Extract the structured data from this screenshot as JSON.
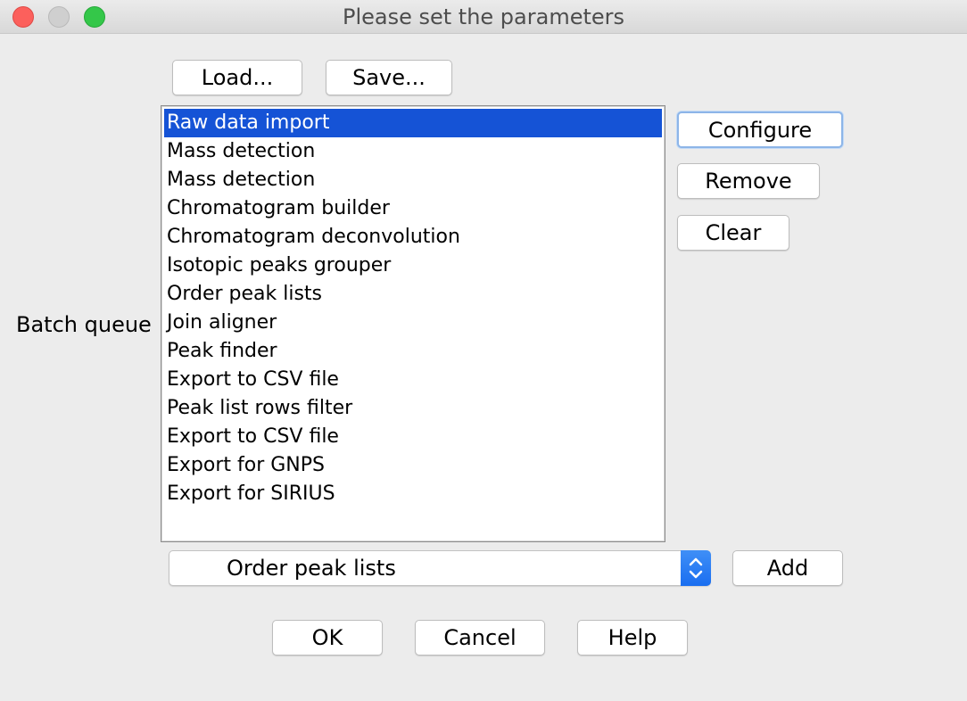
{
  "window": {
    "title": "Please set the parameters"
  },
  "toolbar": {
    "load_label": "Load...",
    "save_label": "Save..."
  },
  "batch_queue": {
    "label": "Batch queue",
    "selected_index": 0,
    "items": [
      "Raw data import",
      "Mass detection",
      "Mass detection",
      "Chromatogram builder",
      "Chromatogram deconvolution",
      "Isotopic peaks grouper",
      "Order peak lists",
      "Join aligner",
      "Peak finder",
      "Export to CSV file",
      "Peak list rows filter",
      "Export to CSV file",
      "Export for GNPS",
      "Export for SIRIUS"
    ]
  },
  "side_buttons": {
    "configure_label": "Configure",
    "remove_label": "Remove",
    "clear_label": "Clear"
  },
  "module_select": {
    "value": "Order peak lists",
    "add_label": "Add"
  },
  "footer": {
    "ok_label": "OK",
    "cancel_label": "Cancel",
    "help_label": "Help"
  },
  "colors": {
    "selection": "#1553d6",
    "combo_arrow": "#1a6ef0",
    "close": "#fc605c",
    "zoom": "#34c749"
  }
}
